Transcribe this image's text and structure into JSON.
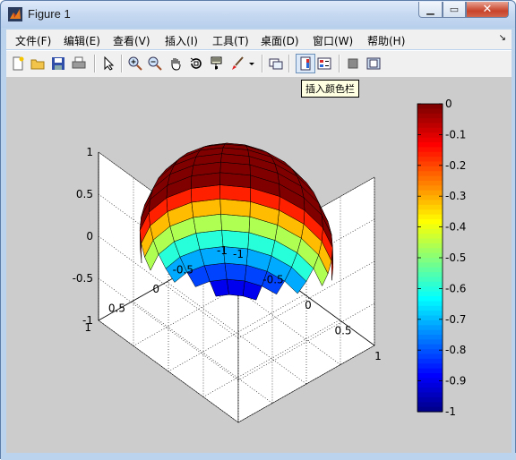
{
  "window": {
    "title": "Figure 1"
  },
  "window_controls": {
    "minimize": "▁",
    "maximize": "▭",
    "close": "✕"
  },
  "menu": {
    "items": [
      "文件(F)",
      "编辑(E)",
      "查看(V)",
      "插入(I)",
      "工具(T)",
      "桌面(D)",
      "窗口(W)",
      "帮助(H)"
    ],
    "corner": "↘"
  },
  "toolbar": {
    "icons": [
      "new-figure-icon",
      "open-icon",
      "save-icon",
      "print-icon",
      "pointer-icon",
      "zoom-in-icon",
      "zoom-out-icon",
      "pan-icon",
      "rotate-3d-icon",
      "data-cursor-icon",
      "brush-icon",
      "link-icon",
      "colorbar-icon",
      "legend-icon",
      "hide-plot-tools-icon",
      "show-plot-tools-icon"
    ],
    "tooltip": "插入颜色栏",
    "active_tool": "colorbar-icon"
  },
  "chart_data": {
    "type": "surface",
    "shape": "sphere",
    "colormap": "jet",
    "axes": {
      "x": {
        "ticks": [
          "-1",
          "-0.5",
          "0",
          "0.5",
          "1"
        ],
        "lim": [
          -1,
          1
        ]
      },
      "y": {
        "ticks": [
          "-1",
          "-0.5",
          "0",
          "0.5",
          "1"
        ],
        "lim": [
          -1,
          1
        ]
      },
      "z": {
        "ticks": [
          "-1",
          "-0.5",
          "0",
          "0.5",
          "1"
        ],
        "lim": [
          -1,
          1
        ]
      }
    },
    "grid": true,
    "colorbar": {
      "lim": [
        -1,
        0
      ],
      "ticks": [
        "0",
        "-0.1",
        "-0.2",
        "-0.3",
        "-0.4",
        "-0.5",
        "-0.6",
        "-0.7",
        "-0.8",
        "-0.9",
        "-1"
      ]
    }
  }
}
